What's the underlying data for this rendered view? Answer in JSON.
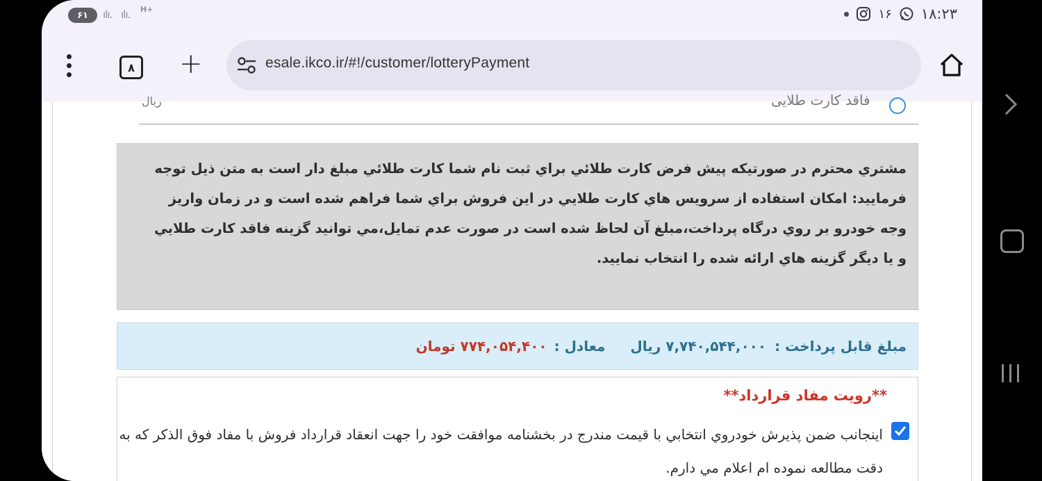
{
  "status_bar": {
    "battery": "۶۱",
    "network": "H+",
    "clock": "۱۸:۲۳",
    "notification_count": "۱۶"
  },
  "browser": {
    "tab_count": "۸",
    "url": "esale.ikco.ir/#!/customer/lotteryPayment"
  },
  "page": {
    "cut_option_label": "فاقد کارت طلایی",
    "cut_left_text": "ریال",
    "notice_text": "مشتري محترم در صورتيکه پيش فرض کارت طلائي براي ثبت نام شما کارت طلائي مبلغ دار است به متن ذيل توجه فرماييد: امکان استفاده از سرويس هاي کارت طلايي در اين فروش براي شما فراهم شده است و در زمان واريز وجه خودرو بر روي درگاه پرداخت،مبلغ آن لحاظ شده است در صورت عدم تمايل،مي توانيد گزينه فاقد کارت طلايي و يا ديگر گزينه هاي ارائه شده را انتخاب نماييد.",
    "payment_label": "مبلغ قابل پرداخت :",
    "payment_amount_rial": "۷,۷۴۰,۵۴۴,۰۰۰ ریال",
    "equivalent_label": "معادل :",
    "payment_amount_toman": "۷۷۴,۰۵۴,۴۰۰ تومان",
    "contract_title": "**رويت مفاد قرارداد**",
    "agreement_checked": true,
    "agreement_text": "اينجانب ضمن پذيرش خودروي انتخابي با قيمت مندرج در بخشنامه موافقت خود را جهت انعقاد قرارداد فروش با مفاد فوق الذکر که به دقت مطالعه نموده ام اعلام مي دارم."
  }
}
